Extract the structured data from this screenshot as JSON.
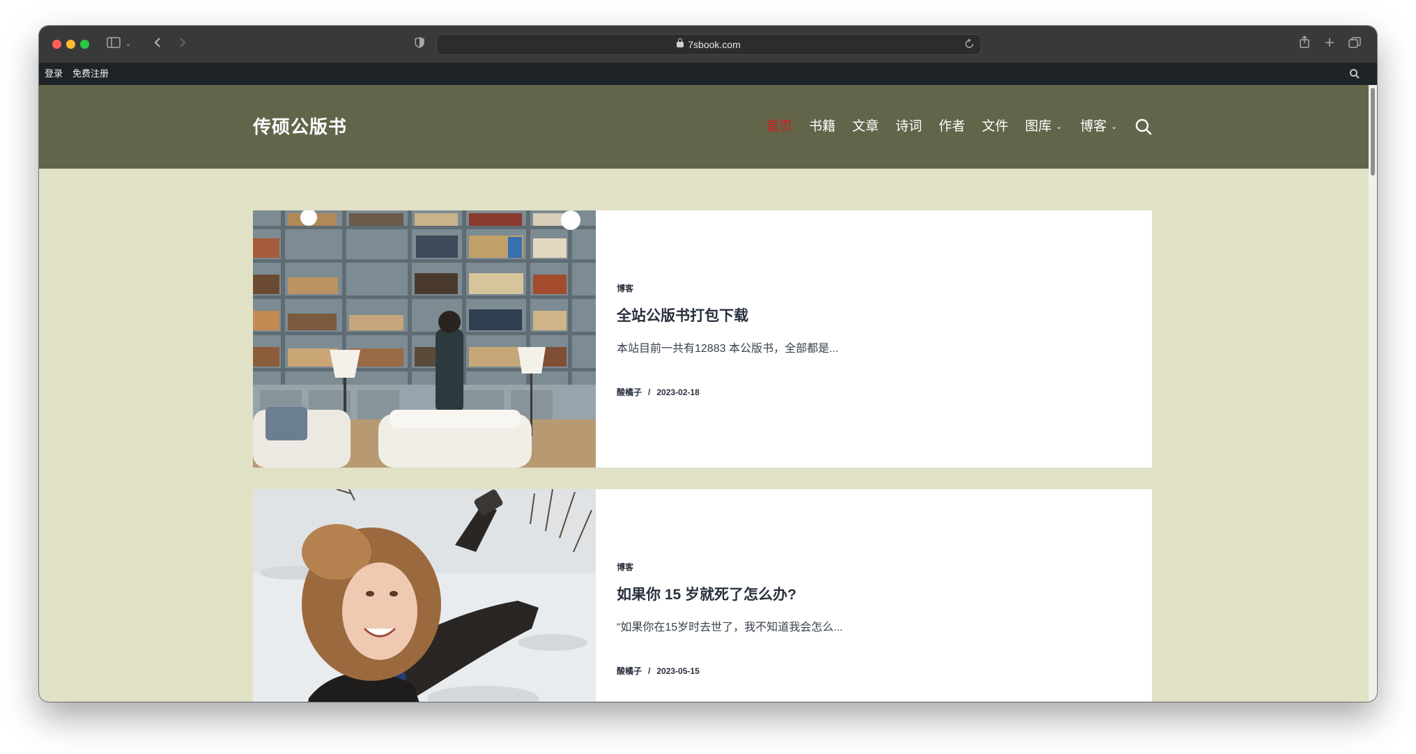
{
  "browser": {
    "url": "7sbook.com"
  },
  "adminbar": {
    "login": "登录",
    "register": "免费注册"
  },
  "site": {
    "title": "传硕公版书"
  },
  "nav": {
    "items": [
      {
        "label": "首页",
        "active": true
      },
      {
        "label": "书籍"
      },
      {
        "label": "文章"
      },
      {
        "label": "诗词"
      },
      {
        "label": "作者"
      },
      {
        "label": "文件"
      },
      {
        "label": "图库",
        "dropdown": true
      },
      {
        "label": "博客",
        "dropdown": true
      }
    ]
  },
  "posts": [
    {
      "category": "博客",
      "title": "全站公版书打包下载",
      "excerpt": "本站目前一共有12883 本公版书，全部都是...",
      "author": "酸橘子",
      "separator": "/",
      "date": "2023-02-18"
    },
    {
      "category": "博客",
      "title": "如果你 15 岁就死了怎么办?",
      "excerpt": "“如果你在15岁时去世了，我不知道我会怎么...",
      "author": "酸橘子",
      "separator": "/",
      "date": "2023-05-15"
    }
  ],
  "colors": {
    "header_bg": "#626549",
    "page_bg": "#e1e1c6",
    "nav_active": "#d01f1f",
    "adminbar_bg": "#1d2327"
  }
}
